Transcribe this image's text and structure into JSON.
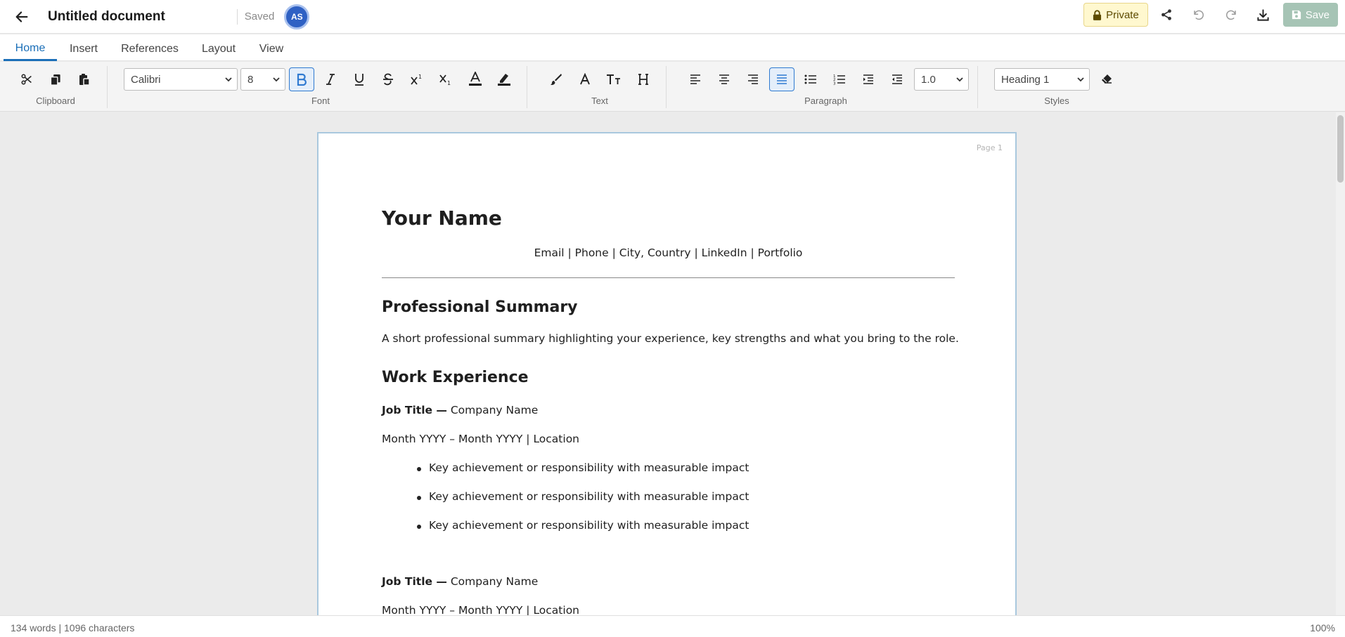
{
  "header": {
    "title": "Untitled document",
    "status": "Saved",
    "avatar_initials": "AS",
    "private_label": "Private",
    "save_label": "Save"
  },
  "tabs": [
    {
      "label": "Home",
      "active": true
    },
    {
      "label": "Insert"
    },
    {
      "label": "References"
    },
    {
      "label": "Layout"
    },
    {
      "label": "View"
    }
  ],
  "ribbon": {
    "groups": {
      "clipboard": "Clipboard",
      "font": "Font",
      "text": "Text",
      "paragraph": "Paragraph",
      "styles": "Styles"
    },
    "font_family": "Calibri",
    "font_size": "8",
    "line_spacing": "1.0",
    "style": "Heading 1",
    "icons": {
      "cut": "scissors-icon",
      "copy": "copy-icon",
      "paste": "paste-icon",
      "bold": "bold-icon",
      "italic": "italic-icon",
      "underline": "underline-icon",
      "strike": "strikethrough-icon",
      "superscript": "superscript-icon",
      "subscript": "subscript-icon",
      "font_color": "font-color-icon",
      "highlight": "highlight-icon",
      "format_painter": "brush-icon",
      "text_style": "text-style-icon",
      "text_size": "text-size-icon",
      "heading": "heading-icon",
      "align_left": "align-left-icon",
      "align_center": "align-center-icon",
      "align_right": "align-right-icon",
      "justify": "justify-icon",
      "bullets": "bullet-list-icon",
      "numbered": "numbered-list-icon",
      "indent": "indent-icon",
      "outdent": "outdent-icon",
      "clear_format": "eraser-icon"
    }
  },
  "document": {
    "page_label": "Page 1",
    "name": "Your Name",
    "contact": "Email | Phone | City, Country | LinkedIn | Portfolio",
    "summary_heading": "Professional Summary",
    "summary_text": "A short professional summary highlighting your experience, key strengths and what you bring to the role.",
    "experience_heading": "Work Experience",
    "jobs": [
      {
        "title": "Job Title —",
        "company": " Company Name",
        "dates": "Month YYYY – Month YYYY | Location",
        "bullets": [
          "Key achievement or responsibility with measurable impact",
          "Key achievement or responsibility with measurable impact",
          "Key achievement or responsibility with measurable impact"
        ]
      },
      {
        "title": "Job Title —",
        "company": " Company Name",
        "dates": "Month YYYY – Month YYYY | Location"
      }
    ]
  },
  "status": {
    "counts": "134 words | 1096 characters",
    "zoom": "100%"
  },
  "colors": {
    "accent": "#1b6fb8",
    "avatar": "#2f61c4",
    "private_bg": "#fff8cf",
    "save_bg": "#a6c4b5"
  }
}
